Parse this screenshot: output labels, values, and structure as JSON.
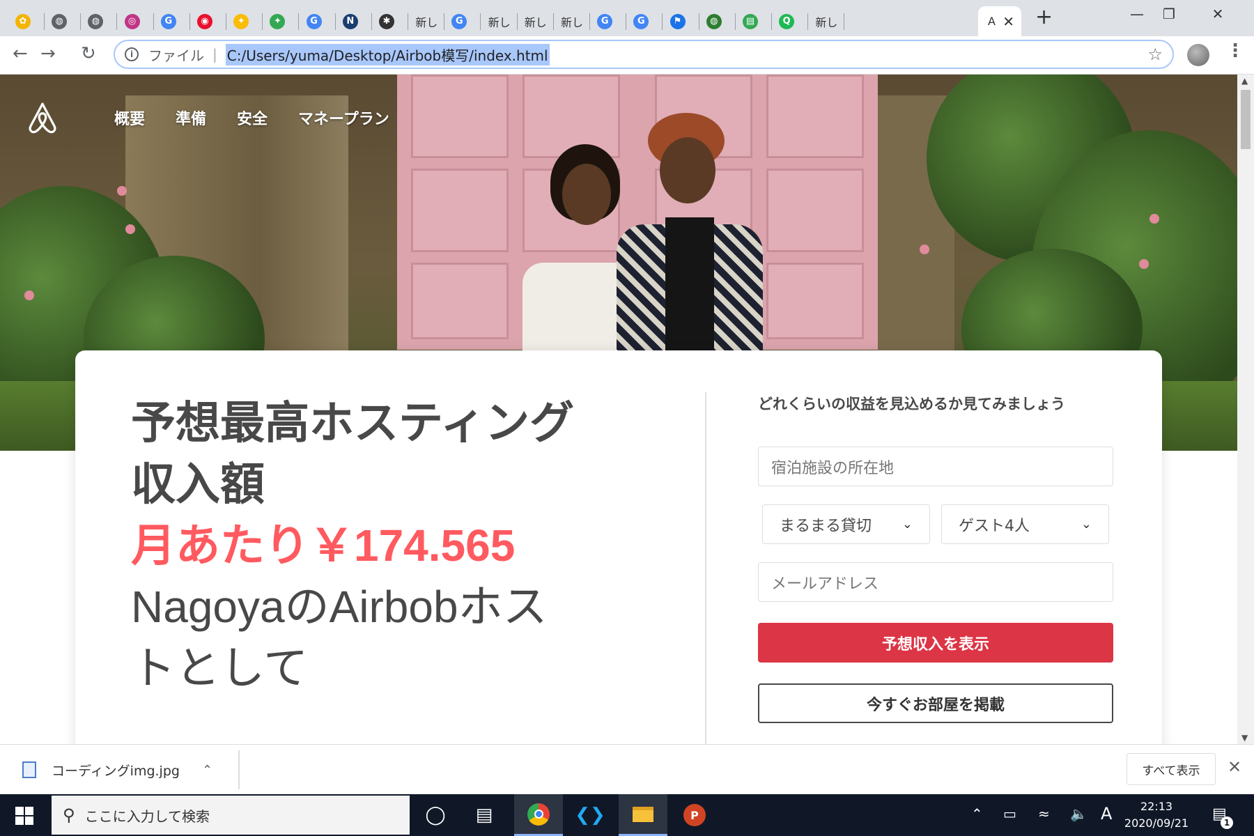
{
  "browser": {
    "tabs": [
      {
        "label": "",
        "icon": "colorful-icon",
        "color": "#f4b400"
      },
      {
        "label": "",
        "icon": "globe-icon",
        "color": "#5f6368"
      },
      {
        "label": "",
        "icon": "globe-icon",
        "color": "#5f6368"
      },
      {
        "label": "",
        "icon": "instagram-icon",
        "color": "#c13584"
      },
      {
        "label": "",
        "icon": "google-icon",
        "color": "#4285f4"
      },
      {
        "label": "",
        "icon": "target-icon",
        "color": "#e8112d"
      },
      {
        "label": "",
        "icon": "pinwheel-icon",
        "color": "#fbbc05"
      },
      {
        "label": "",
        "icon": "pinwheel-icon",
        "color": "#34a853"
      },
      {
        "label": "",
        "icon": "google-icon",
        "color": "#4285f4"
      },
      {
        "label": "",
        "icon": "n-icon",
        "color": "#1a3e6e"
      },
      {
        "label": "",
        "icon": "asterisk-icon",
        "color": "#333333"
      },
      {
        "label": "新し",
        "icon": "",
        "color": ""
      },
      {
        "label": "",
        "icon": "google-icon",
        "color": "#4285f4"
      },
      {
        "label": "新し",
        "icon": "",
        "color": ""
      },
      {
        "label": "新し",
        "icon": "",
        "color": ""
      },
      {
        "label": "新し",
        "icon": "",
        "color": ""
      },
      {
        "label": "",
        "icon": "google-icon",
        "color": "#4285f4"
      },
      {
        "label": "",
        "icon": "google-icon",
        "color": "#4285f4"
      },
      {
        "label": "",
        "icon": "flag-icon",
        "color": "#1a73e8"
      },
      {
        "label": "",
        "icon": "globe-green-icon",
        "color": "#2e7d32"
      },
      {
        "label": "",
        "icon": "book-icon",
        "color": "#34a853"
      },
      {
        "label": "",
        "icon": "q-icon",
        "color": "#1db954"
      },
      {
        "label": "新し",
        "icon": "",
        "color": ""
      }
    ],
    "active_tab_label": "A",
    "address_scheme": "ファイル",
    "address_url": "C:/Users/yuma/Desktop/Airbob模写/index.html"
  },
  "site": {
    "nav": [
      "概要",
      "準備",
      "安全",
      "マネープラン"
    ],
    "headline_line1": "予想最高ホスティング",
    "headline_line2": "収入額",
    "headline_price": "月あたり￥174.565",
    "headline_host_line1": "NagoyaのAirbobホス",
    "headline_host_line2": "トとして",
    "form_title": "どれくらいの収益を見込めるか見てみましょう",
    "location_placeholder": "宿泊施設の所在地",
    "room_type": "まるまる貸切",
    "guests": "ゲスト4人",
    "email_placeholder": "メールアドレス",
    "estimate_button": "予想収入を表示",
    "list_button": "今すぐお部屋を掲載"
  },
  "download_bar": {
    "file_name": "コーディングimg.jpg",
    "show_all": "すべて表示"
  },
  "taskbar": {
    "search_placeholder": "ここに入力して検索",
    "time": "22:13",
    "date": "2020/09/21",
    "ime": "A",
    "notifications": "1"
  },
  "colors": {
    "brand_accent": "#ff5a5f",
    "primary_button": "#dc3545",
    "headline": "#484848"
  }
}
